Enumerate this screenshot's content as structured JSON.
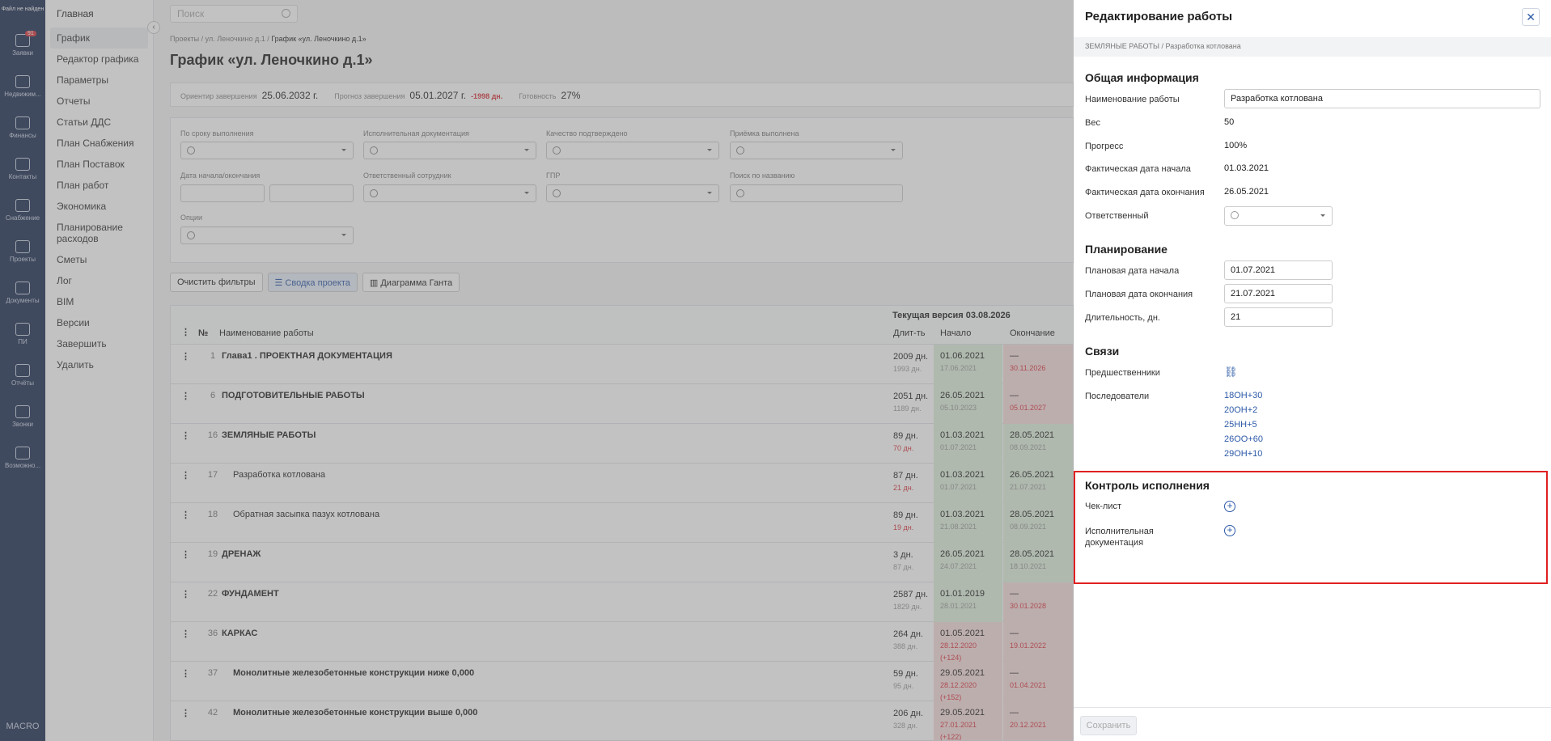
{
  "rail": {
    "logo": "Файл не найден",
    "items": [
      {
        "label": "Заявки",
        "icon": "requests-icon",
        "badge": "91"
      },
      {
        "label": "Недвижим...",
        "icon": "realty-icon"
      },
      {
        "label": "Финансы",
        "icon": "finance-icon"
      },
      {
        "label": "Контакты",
        "icon": "contacts-icon"
      },
      {
        "label": "Снабжение",
        "icon": "truck-icon"
      },
      {
        "label": "Проекты",
        "icon": "projects-icon"
      },
      {
        "label": "Документы",
        "icon": "documents-icon"
      },
      {
        "label": "ПИ",
        "icon": "monitor-icon"
      },
      {
        "label": "Отчёты",
        "icon": "reports-icon"
      },
      {
        "label": "Звонки",
        "icon": "phone-icon"
      },
      {
        "label": "Возможно...",
        "icon": "gear-icon"
      }
    ],
    "brand": "MACRO"
  },
  "nav": {
    "home": "Главная",
    "items": [
      "График",
      "Редактор графика",
      "Параметры",
      "Отчеты",
      "Статьи ДДС",
      "План Снабжения",
      "План Поставок",
      "План работ",
      "Экономика",
      "Планирование расходов",
      "Сметы",
      "Лог",
      "BIM",
      "Версии",
      "Завершить",
      "Удалить"
    ]
  },
  "main": {
    "search_placeholder": "Поиск",
    "crumbs": [
      "Проекты",
      "ул. Леночкино д.1",
      "График «ул. Леночкино д.1»"
    ],
    "title": "График «ул. Леночкино д.1»",
    "info": {
      "end_label": "Ориентир завершения",
      "end_value": "25.06.2032 г.",
      "forecast_label": "Прогноз завершения",
      "forecast_value": "05.01.2027 г.",
      "forecast_delta": "-1998 дн.",
      "ready_label": "Готовность",
      "ready_value": "27%"
    },
    "filters": {
      "f1": "По сроку выполнения",
      "f2": "Исполнительная документация",
      "f3": "Качество подтверждено",
      "f4": "Приёмка выполнена",
      "f5": "Дата начала/окончания",
      "f6": "Ответственный сотрудник",
      "f7": "ГПР",
      "f8": "Поиск по названию",
      "f9": "Опции"
    },
    "buttons": {
      "clear": "Очистить фильтры",
      "summary": "Сводка проекта",
      "gantt": "Диаграмма Ганта"
    },
    "table": {
      "version": "Текущая версия 03.08.2026",
      "h_num": "№",
      "h_name": "Наименование работы",
      "h_dur": "Длит-ть",
      "h_start": "Начало",
      "h_end": "Окончание",
      "rows": [
        {
          "n": "1",
          "name": "Глава1 . ПРОЕКТНАЯ ДОКУМЕНТАЦИЯ",
          "dur": "2009 дн.",
          "dur2": "1993 дн.",
          "s": "01.06.2021",
          "s2": "17.06.2021",
          "e": "—",
          "e2": "30.11.2026"
        },
        {
          "n": "6",
          "name": "ПОДГОТОВИТЕЛЬНЫЕ РАБОТЫ",
          "dur": "2051 дн.",
          "dur2": "1189 дн.",
          "s": "26.05.2021",
          "s2": "05.10.2023",
          "e": "—",
          "e2": "05.01.2027"
        },
        {
          "n": "16",
          "name": "ЗЕМЛЯНЫЕ РАБОТЫ",
          "dur": "89 дн.",
          "dur2": "70 дн.",
          "s": "01.03.2021",
          "s2": "01.07.2021",
          "e": "28.05.2021",
          "e2": "08.09.2021"
        },
        {
          "n": "17",
          "name": "Разработка котлована",
          "dur": "87 дн.",
          "dur2": "21 дн.",
          "s": "01.03.2021",
          "s2": "01.07.2021",
          "e": "26.05.2021",
          "e2": "21.07.2021"
        },
        {
          "n": "18",
          "name": "Обратная засыпка пазух котлована",
          "dur": "89 дн.",
          "dur2": "19 дн.",
          "s": "01.03.2021",
          "s2": "21.08.2021",
          "e": "28.05.2021",
          "e2": "08.09.2021"
        },
        {
          "n": "19",
          "name": "ДРЕНАЖ",
          "dur": "3 дн.",
          "dur2": "87 дн.",
          "s": "26.05.2021",
          "s2": "24.07.2021",
          "e": "28.05.2021",
          "e2": "18.10.2021"
        },
        {
          "n": "22",
          "name": "ФУНДАМЕНТ",
          "dur": "2587 дн.",
          "dur2": "1829 дн.",
          "s": "01.01.2019",
          "s2": "28.01.2021",
          "e": "—",
          "e2": "30.01.2028"
        },
        {
          "n": "36",
          "name": "КАРКАС",
          "dur": "264 дн.",
          "dur2": "388 дн.",
          "s": "01.05.2021",
          "s2": "28.12.2020 (+124)",
          "e": "—",
          "e2": "19.01.2022"
        },
        {
          "n": "37",
          "name": "Монолитные железобетонные конструкции ниже 0,000",
          "dur": "59 дн.",
          "dur2": "95 дн.",
          "s": "29.05.2021",
          "s2": "28.12.2020 (+152)",
          "e": "—",
          "e2": "01.04.2021"
        },
        {
          "n": "42",
          "name": "Монолитные железобетонные конструкции выше 0,000",
          "dur": "206 дн.",
          "dur2": "328 дн.",
          "s": "29.05.2021",
          "s2": "27.01.2021 (+122)",
          "e": "—",
          "e2": "20.12.2021"
        }
      ]
    }
  },
  "panel": {
    "title": "Редактирование работы",
    "breadcrumb": "ЗЕМЛЯНЫЕ РАБОТЫ / Разработка котлована",
    "general": "Общая информация",
    "name_label": "Наименование работы",
    "name_value": "Разработка котлована",
    "weight_label": "Вес",
    "weight_value": "50",
    "progress_label": "Прогресс",
    "progress_value": "100%",
    "fstart_label": "Фактическая дата начала",
    "fstart_value": "01.03.2021",
    "fend_label": "Фактическая дата окончания",
    "fend_value": "26.05.2021",
    "resp_label": "Ответственный",
    "planning": "Планирование",
    "pstart_label": "Плановая дата начала",
    "pstart_value": "01.07.2021",
    "pend_label": "Плановая дата окончания",
    "pend_value": "21.07.2021",
    "dur_label": "Длительность, дн.",
    "dur_value": "21",
    "links": "Связи",
    "pred_label": "Предшественники",
    "succ_label": "Последователи",
    "successors": [
      "18ОН+30",
      "20ОН+2",
      "25НН+5",
      "26ОО+60",
      "29ОН+10"
    ],
    "control": "Контроль исполнения",
    "checklist_label": "Чек-лист",
    "docs_label": "Исполнительная документация",
    "save": "Сохранить"
  }
}
